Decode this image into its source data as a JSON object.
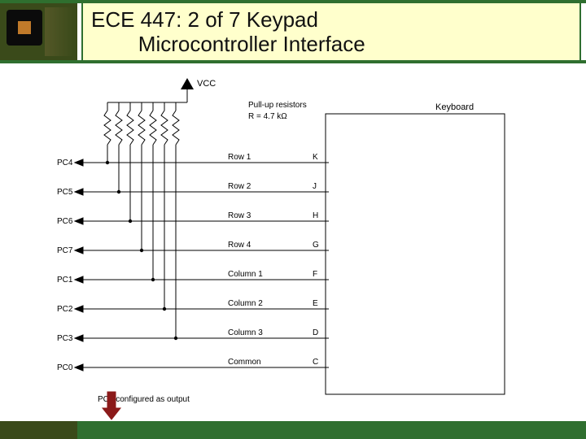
{
  "title_line1": "ECE 447: 2 of 7 Keypad",
  "title_line2": "Microcontroller Interface",
  "diagram": {
    "vcc": "VCC",
    "pullups_line1": "Pull-up resistors",
    "pullups_line2": "R  =  4.7 kΩ",
    "keyboard_label": "Keyboard",
    "footnote": "PC0 configured as output",
    "lines": [
      {
        "port": "PC4",
        "signal": "Row 1",
        "pin": "K"
      },
      {
        "port": "PC5",
        "signal": "Row 2",
        "pin": "J"
      },
      {
        "port": "PC6",
        "signal": "Row 3",
        "pin": "H"
      },
      {
        "port": "PC7",
        "signal": "Row 4",
        "pin": "G"
      },
      {
        "port": "PC1",
        "signal": "Column 1",
        "pin": "F"
      },
      {
        "port": "PC2",
        "signal": "Column 2",
        "pin": "E"
      },
      {
        "port": "PC3",
        "signal": "Column 3",
        "pin": "D"
      },
      {
        "port": "PC0",
        "signal": "Common",
        "pin": "C"
      }
    ]
  }
}
